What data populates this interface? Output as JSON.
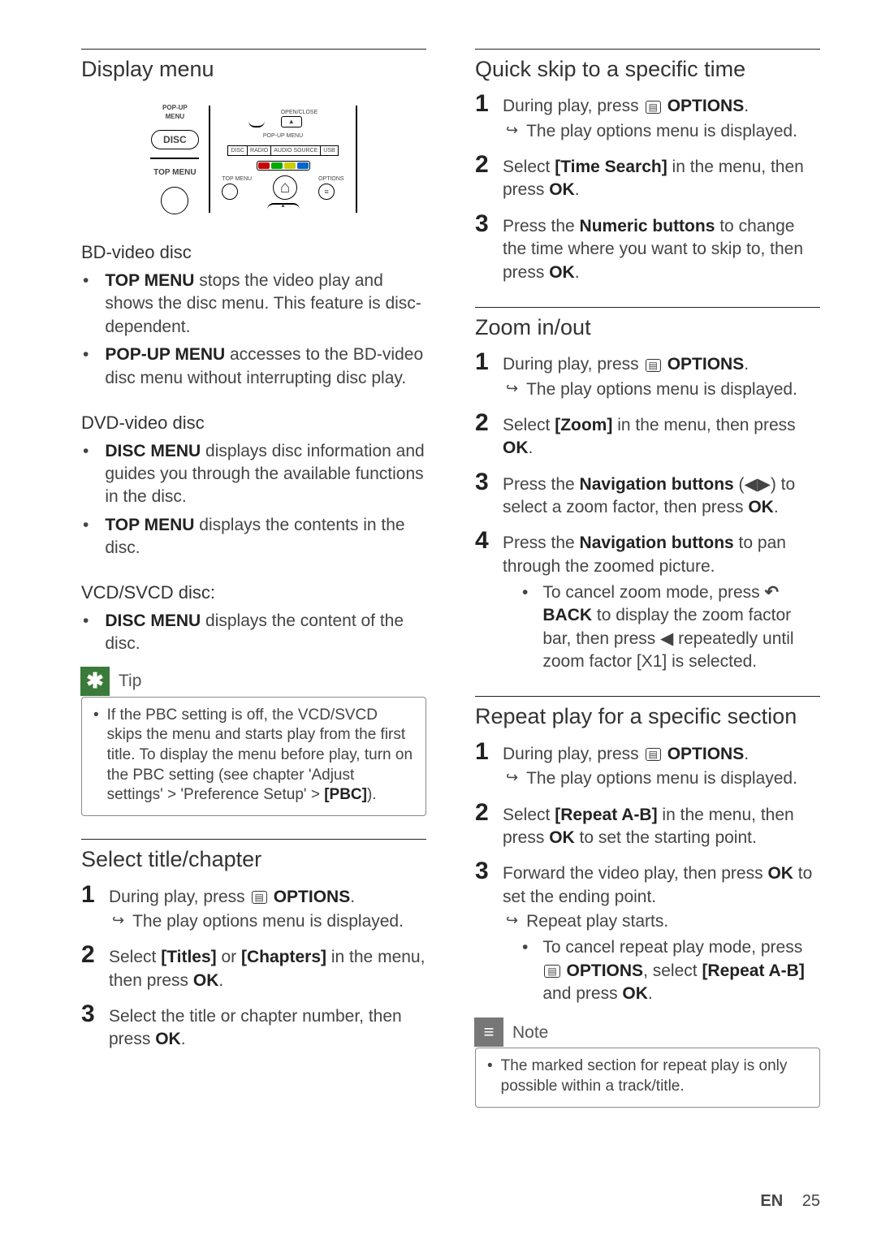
{
  "left": {
    "displayMenu": {
      "title": "Display menu",
      "remote": {
        "popup": "POP-UP\nMENU",
        "disc": "DISC",
        "topmenu": "TOP MENU",
        "openclose": "OPEN/CLOSE",
        "popup2": "POP-UP MENU",
        "src1": "DISC",
        "src2": "RADIO",
        "src3": "AUDIO SOURCE",
        "src4": "USB",
        "topmenu2": "TOP MENU",
        "options": "OPTIONS"
      },
      "bd": {
        "title": "BD-video disc",
        "b1a": "TOP MENU",
        "b1b": " stops the video play and shows the disc menu. This feature is disc-dependent.",
        "b2a": "POP-UP MENU",
        "b2b": " accesses to the BD-video disc menu without interrupting disc play."
      },
      "dvd": {
        "title": "DVD-video disc",
        "b1a": "DISC MENU",
        "b1b": " displays disc information and guides you through the available functions in the disc.",
        "b2a": "TOP MENU",
        "b2b": " displays the contents in the disc."
      },
      "vcd": {
        "title": "VCD/SVCD disc:",
        "b1a": "DISC MENU",
        "b1b": " displays the content of the disc."
      },
      "tip": {
        "label": "Tip",
        "body1": "If the PBC setting is off, the VCD/SVCD skips the menu and starts play from the first title. To display the menu before play, turn on the PBC setting (see chapter 'Adjust settings' > 'Preference Setup' > ",
        "body2": "[PBC]",
        "body3": ")."
      }
    },
    "selectTitle": {
      "title": "Select title/chapter",
      "s1a": "During play, press ",
      "s1b": " OPTIONS",
      "s1c": ".",
      "s1r": "The play options menu is displayed.",
      "s2a": "Select ",
      "s2b": "[Titles]",
      "s2c": " or ",
      "s2d": "[Chapters]",
      "s2e": " in the menu, then press ",
      "s2f": "OK",
      "s2g": ".",
      "s3a": "Select the title or chapter number, then press ",
      "s3b": "OK",
      "s3c": "."
    }
  },
  "right": {
    "quickSkip": {
      "title": "Quick skip to a specific time",
      "s1a": "During play, press ",
      "s1b": " OPTIONS",
      "s1c": ".",
      "s1r": "The play options menu is displayed.",
      "s2a": "Select ",
      "s2b": "[Time Search]",
      "s2c": " in the menu, then press ",
      "s2d": "OK",
      "s2e": ".",
      "s3a": "Press the ",
      "s3b": "Numeric buttons",
      "s3c": " to change the time where you want to skip to, then press ",
      "s3d": "OK",
      "s3e": "."
    },
    "zoom": {
      "title": "Zoom in/out",
      "s1a": "During play, press ",
      "s1b": " OPTIONS",
      "s1c": ".",
      "s1r": "The play options menu is displayed.",
      "s2a": "Select ",
      "s2b": "[Zoom]",
      "s2c": " in the menu, then press ",
      "s2d": "OK",
      "s2e": ".",
      "s3a": "Press the ",
      "s3b": "Navigation buttons",
      "s3c": " (",
      "s3d": ") to select a zoom factor, then press ",
      "s3e": "OK",
      "s3f": ".",
      "s4a": "Press the ",
      "s4b": "Navigation buttons",
      "s4c": " to pan through the zoomed picture.",
      "s4sub1": "To cancel zoom mode, press ",
      "s4sub2": "BACK",
      "s4sub3": " to display the zoom factor bar, then press ",
      "s4sub4": " repeatedly until zoom factor [X1] is selected."
    },
    "repeat": {
      "title": "Repeat play for a specific section",
      "s1a": "During play, press ",
      "s1b": " OPTIONS",
      "s1c": ".",
      "s1r": "The play options menu is displayed.",
      "s2a": "Select ",
      "s2b": "[Repeat A-B]",
      "s2c": " in the menu, then press ",
      "s2d": "OK",
      "s2e": " to set the starting point.",
      "s3a": "Forward the video play, then press ",
      "s3b": "OK",
      "s3c": " to set the ending point.",
      "s3r": "Repeat play starts.",
      "s3sub1": "To cancel repeat play mode, press ",
      "s3sub2": "OPTIONS",
      "s3sub3": ", select ",
      "s3sub4": "[Repeat A-B]",
      "s3sub5": " and press ",
      "s3sub6": "OK",
      "s3sub7": "."
    },
    "note": {
      "label": "Note",
      "body": "The marked section for repeat play is only possible within a track/title."
    }
  },
  "footer": {
    "lang": "EN",
    "page": "25"
  }
}
